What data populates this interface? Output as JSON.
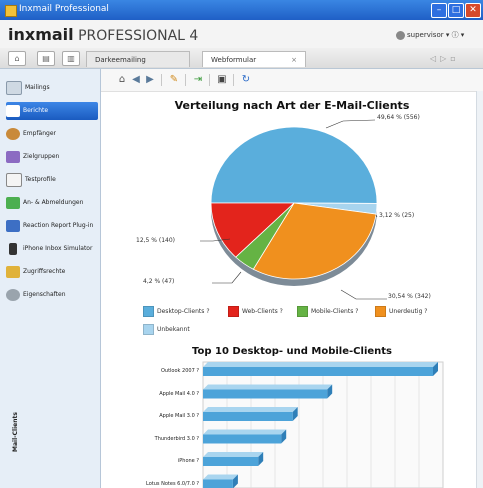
{
  "window": {
    "title": "Inxmail Professional"
  },
  "header": {
    "logo_bold": "inx",
    "logo_rest": "mail",
    "logo_product": " PROFESSIONAL 4",
    "user": "supervisor ▾ ⓘ ▾"
  },
  "tabs": [
    {
      "label": "Darkeemailing"
    },
    {
      "label": "Webformular"
    }
  ],
  "sidebar": {
    "items": [
      {
        "label": "Mailings"
      },
      {
        "label": "Berichte"
      },
      {
        "label": "Empfänger"
      },
      {
        "label": "Zielgruppen"
      },
      {
        "label": "Testprofile"
      },
      {
        "label": "An- & Abmeldungen"
      },
      {
        "label": "Reaction Report Plug-in"
      },
      {
        "label": "iPhone Inbox Simulator"
      },
      {
        "label": "Zugriffsrechte"
      },
      {
        "label": "Eigenschaften"
      }
    ]
  },
  "colors": {
    "desktop": "#5aaedc",
    "web": "#e3241c",
    "mobile": "#65b344",
    "unknown_os": "#f0901e",
    "unknown": "#a8d4ee"
  },
  "pie_chart": {
    "title": "Verteilung nach Art der E-Mail-Clients",
    "annotations": {
      "desktop": "49,64 % (556)",
      "unknown": "3,12 % (25)",
      "web": "12,5 % (140)",
      "mobile": "4,2 % (47)",
      "unknown_os": "30,54 % (342)"
    },
    "legend": {
      "desktop": "Desktop-Clients ?",
      "web": "Web-Clients ?",
      "mobile": "Mobile-Clients ?",
      "unknown_os": "Unerdeutig ?",
      "unknown": "Unbekannt"
    }
  },
  "bar_chart": {
    "title": "Top 10 Desktop- und Mobile-Clients",
    "axis_title": "Mail-Clients"
  },
  "chart_data": [
    {
      "type": "pie",
      "title": "Verteilung nach Art der E-Mail-Clients",
      "slices": [
        {
          "name": "Desktop-Clients",
          "value": 556,
          "percent": 49.64
        },
        {
          "name": "Unbekannt",
          "value": 25,
          "percent": 3.12
        },
        {
          "name": "Unerdeutig",
          "value": 342,
          "percent": 30.54
        },
        {
          "name": "Mobile-Clients",
          "value": 47,
          "percent": 4.2
        },
        {
          "name": "Web-Clients",
          "value": 140,
          "percent": 12.5
        }
      ]
    },
    {
      "type": "bar",
      "title": "Top 10 Desktop- und Mobile-Clients",
      "ylabel": "Mail-Clients",
      "categories": [
        "Outlook 2007 ?",
        "Apple Mail 4.0 ?",
        "Apple Mail 3.0 ?",
        "Thunderbird 3.0 ?",
        "iPhone ?",
        "Lotus Notes 6.0/7.0 ?"
      ],
      "values": [
        100,
        54,
        39,
        34,
        24,
        13
      ],
      "xlim": [
        0,
        100
      ]
    }
  ]
}
